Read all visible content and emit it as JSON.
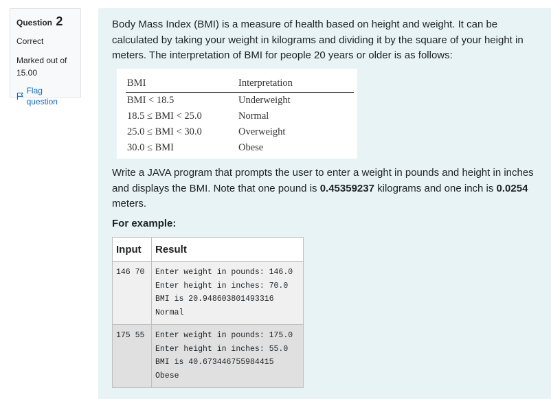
{
  "info": {
    "question_label": "Question",
    "question_number": "2",
    "state": "Correct",
    "grade_line1": "Marked out of",
    "grade_line2": "15.00",
    "flag_label": "Flag question"
  },
  "question": {
    "intro": "Body Mass Index (BMI) is a measure of health based on height and weight. It can be calculated by taking your weight in kilograms and dividing it by the square of your height in meters. The interpretation of BMI for people 20 years or older is as follows:",
    "bmi_table": {
      "headers": [
        "BMI",
        "Interpretation"
      ],
      "rows": [
        [
          "BMI < 18.5",
          "Underweight"
        ],
        [
          "18.5 ≤ BMI < 25.0",
          "Normal"
        ],
        [
          "25.0 ≤ BMI < 30.0",
          "Overweight"
        ],
        [
          "30.0 ≤ BMI",
          "Obese"
        ]
      ]
    },
    "para2_a": "Write a JAVA program that prompts the user to enter a weight in pounds and height in inches and displays the BMI. Note that one pound is ",
    "para2_pound": "0.45359237",
    "para2_b": " kilograms and one inch is ",
    "para2_inch": "0.0254",
    "para2_c": " meters.",
    "for_example": "For example:",
    "example_headers": [
      "Input",
      "Result"
    ],
    "examples": [
      {
        "input": "146 70",
        "result": "Enter weight in pounds: 146.0\nEnter height in inches: 70.0\nBMI is 20.948603801493316\nNormal"
      },
      {
        "input": "175 55",
        "result": "Enter weight in pounds: 175.0\nEnter height in inches: 55.0\nBMI is 40.673446755984415\nObese"
      }
    ]
  },
  "colors": {
    "panel_bg": "#e7f3f5",
    "link": "#0f6cbf",
    "row_odd": "#f0f0f0",
    "row_even": "#e0e0e0"
  }
}
